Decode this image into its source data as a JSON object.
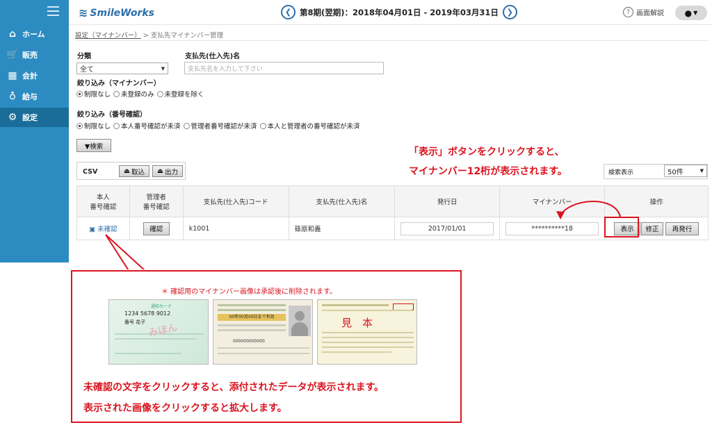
{
  "app": {
    "logo": "SmileWorks"
  },
  "header": {
    "prev_icon": "chevron-left-icon",
    "next_icon": "chevron-right-icon",
    "period": "第8期(翌期)：2018年04月01日 - 2019年03月31日",
    "help_label": "画面解説"
  },
  "sidebar": {
    "items": [
      {
        "label": "ホーム",
        "icon": "home-icon"
      },
      {
        "label": "販売",
        "icon": "cart-icon"
      },
      {
        "label": "会計",
        "icon": "calculator-icon"
      },
      {
        "label": "給与",
        "icon": "money-bag-icon"
      },
      {
        "label": "設定",
        "icon": "gear-icon"
      }
    ]
  },
  "breadcrumb": {
    "parent": "設定（マイナンバー）",
    "sep": ">",
    "current": "支払先マイナンバー管理"
  },
  "filters": {
    "category_label": "分類",
    "category_value": "全て",
    "payee_label": "支払先(仕入先)名",
    "payee_placeholder": "支払先名を入力して下さい",
    "mynumber_label": "絞り込み（マイナンバー）",
    "mynumber_options": [
      "制限なし",
      "未登録のみ",
      "未登録を除く"
    ],
    "confirm_label": "絞り込み（番号確認）",
    "confirm_options": [
      "制限なし",
      "本人番号確認が未済",
      "管理者番号確認が未済",
      "本人と管理者の番号確認が未済"
    ],
    "search_button": "▼検索"
  },
  "csv": {
    "label": "CSV",
    "import": "取込",
    "export": "出力"
  },
  "notes": {
    "top_line1": "「表示」ボタンをクリックすると、",
    "top_line2": "マイナンバー12桁が表示されます。",
    "callout_caption": "＊ 確認用のマイナンバー画像は承認後に削除されます。",
    "callout_line1": "未確認の文字をクリックすると、添付されたデータが表示されます。",
    "callout_line2": "表示された画像をクリックすると拡大します。"
  },
  "search_display": {
    "label": "検索表示",
    "value": "50件"
  },
  "table": {
    "headers": [
      "本人\n番号確認",
      "管理者\n番号確認",
      "支払先(仕入先)コード",
      "支払先(仕入先)名",
      "発行日",
      "マイナンバー",
      "操作"
    ],
    "row": {
      "self_status": "未確認",
      "admin_button": "確認",
      "code": "k1001",
      "name": "篠原和義",
      "issue_date": "2017/01/01",
      "mynumber": "**********18",
      "show": "表示",
      "edit": "修正",
      "reissue": "再発行"
    }
  },
  "cards": {
    "notice_card": {
      "title": "通知カード",
      "number": "1234 5678 9012",
      "name": "番号 花子",
      "stamp": "みほん"
    },
    "license_card": {
      "expiry": "00年00月00日まで有効",
      "number": "000000000000"
    },
    "insurance_card": {
      "stamp": "見　本"
    }
  },
  "colors": {
    "sidebar": "#2c8cc1",
    "accent": "#2c6ea8",
    "note_red": "#d9141f"
  }
}
